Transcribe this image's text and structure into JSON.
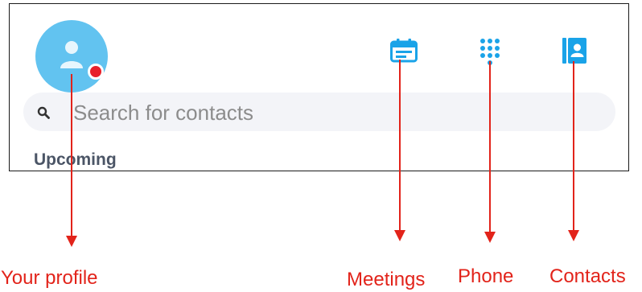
{
  "toolbar": {
    "avatar_icon": "person-icon",
    "status": "busy",
    "meetings_icon": "calendar-icon",
    "phone_icon": "dialpad-icon",
    "contacts_icon": "contacts-book-icon"
  },
  "search": {
    "icon": "search-icon",
    "placeholder": "Search for contacts"
  },
  "section": {
    "upcoming_label": "Upcoming"
  },
  "callouts": {
    "profile": "Your profile",
    "meetings": "Meetings",
    "phone": "Phone",
    "contacts": "Contacts"
  },
  "colors": {
    "accent": "#1aa3e8",
    "avatar": "#62c3f0",
    "status_busy": "#e8202a",
    "annotation": "#e2231a",
    "section_label": "#4b5566",
    "search_bg": "#f3f4f8"
  }
}
